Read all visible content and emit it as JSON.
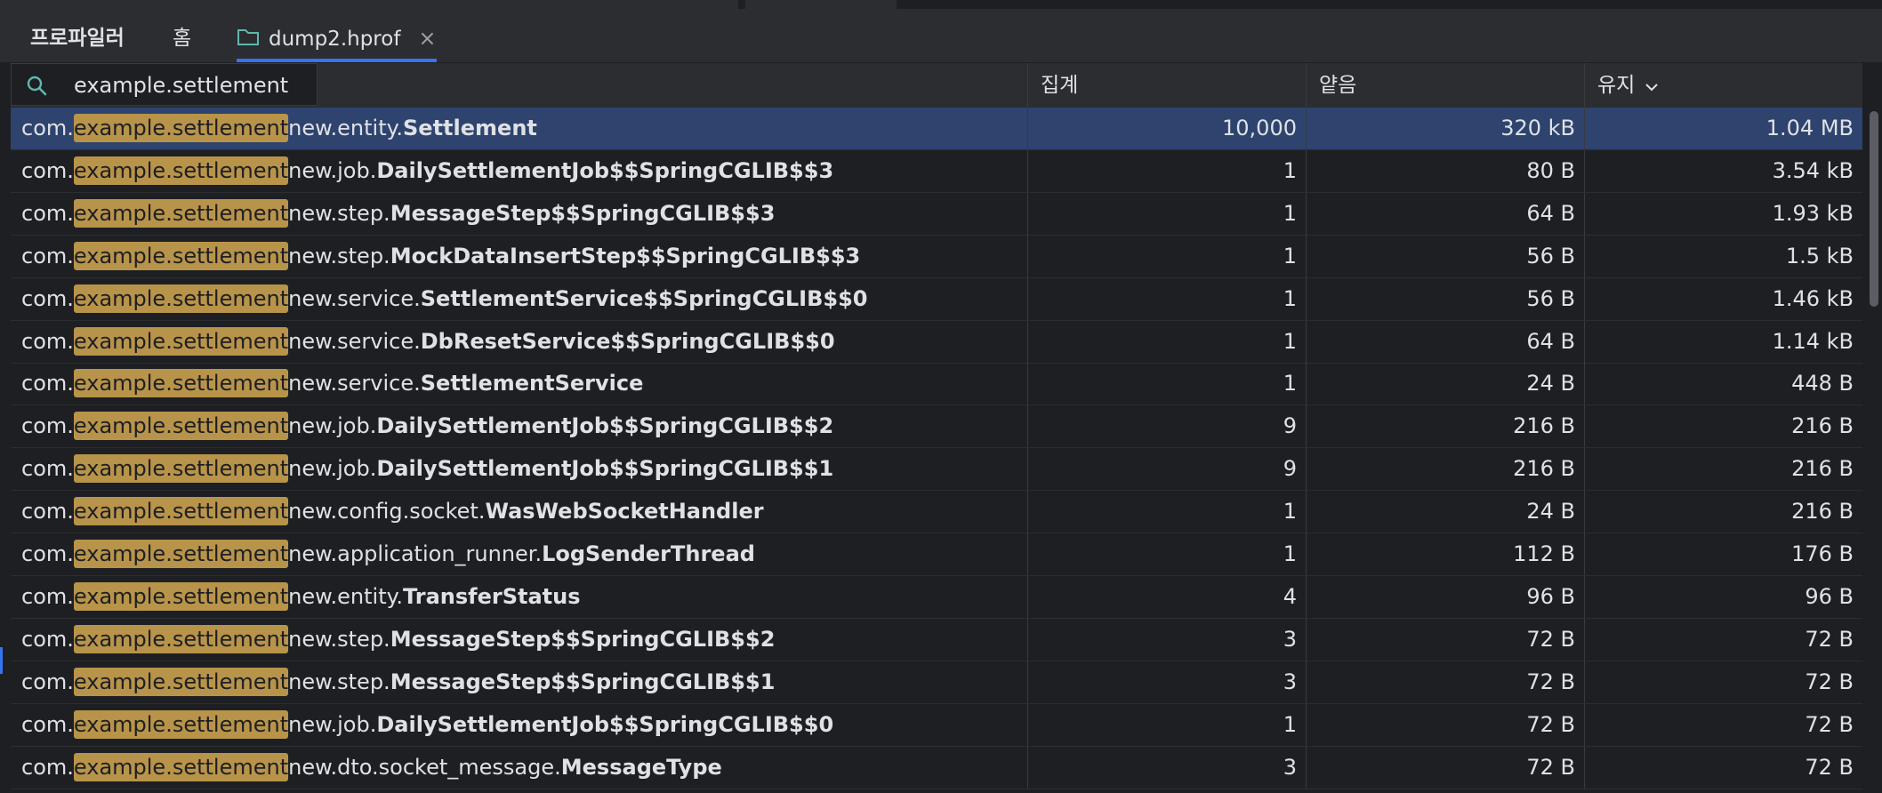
{
  "tabs": [
    {
      "label": "프로파일러"
    },
    {
      "label": "홈"
    },
    {
      "label": "dump2.hprof",
      "icon": "folder-icon",
      "close": "×"
    }
  ],
  "search": {
    "value": "example.settlement",
    "icon": "search-icon"
  },
  "columns": {
    "name": "",
    "count": "집계",
    "shallow": "얕음",
    "retained": "유지"
  },
  "colors": {
    "accent": "#3574f0",
    "highlight": "#b8944a",
    "selected_row": "#2e436e"
  },
  "rows": [
    {
      "prefix": "com.",
      "match": "example.settlement",
      "pkg": "new.entity.",
      "cls": "Settlement",
      "count": "10,000",
      "shallow": "320 kB",
      "retained": "1.04 MB",
      "selected": true
    },
    {
      "prefix": "com.",
      "match": "example.settlement",
      "pkg": "new.job.",
      "cls": "DailySettlementJob$$SpringCGLIB$$3",
      "count": "1",
      "shallow": "80 B",
      "retained": "3.54 kB"
    },
    {
      "prefix": "com.",
      "match": "example.settlement",
      "pkg": "new.step.",
      "cls": "MessageStep$$SpringCGLIB$$3",
      "count": "1",
      "shallow": "64 B",
      "retained": "1.93 kB"
    },
    {
      "prefix": "com.",
      "match": "example.settlement",
      "pkg": "new.step.",
      "cls": "MockDataInsertStep$$SpringCGLIB$$3",
      "count": "1",
      "shallow": "56 B",
      "retained": "1.5 kB"
    },
    {
      "prefix": "com.",
      "match": "example.settlement",
      "pkg": "new.service.",
      "cls": "SettlementService$$SpringCGLIB$$0",
      "count": "1",
      "shallow": "56 B",
      "retained": "1.46 kB"
    },
    {
      "prefix": "com.",
      "match": "example.settlement",
      "pkg": "new.service.",
      "cls": "DbResetService$$SpringCGLIB$$0",
      "count": "1",
      "shallow": "64 B",
      "retained": "1.14 kB"
    },
    {
      "prefix": "com.",
      "match": "example.settlement",
      "pkg": "new.service.",
      "cls": "SettlementService",
      "count": "1",
      "shallow": "24 B",
      "retained": "448 B"
    },
    {
      "prefix": "com.",
      "match": "example.settlement",
      "pkg": "new.job.",
      "cls": "DailySettlementJob$$SpringCGLIB$$2",
      "count": "9",
      "shallow": "216 B",
      "retained": "216 B"
    },
    {
      "prefix": "com.",
      "match": "example.settlement",
      "pkg": "new.job.",
      "cls": "DailySettlementJob$$SpringCGLIB$$1",
      "count": "9",
      "shallow": "216 B",
      "retained": "216 B"
    },
    {
      "prefix": "com.",
      "match": "example.settlement",
      "pkg": "new.config.socket.",
      "cls": "WasWebSocketHandler",
      "count": "1",
      "shallow": "24 B",
      "retained": "216 B"
    },
    {
      "prefix": "com.",
      "match": "example.settlement",
      "pkg": "new.application_runner.",
      "cls": "LogSenderThread",
      "count": "1",
      "shallow": "112 B",
      "retained": "176 B"
    },
    {
      "prefix": "com.",
      "match": "example.settlement",
      "pkg": "new.entity.",
      "cls": "TransferStatus",
      "count": "4",
      "shallow": "96 B",
      "retained": "96 B"
    },
    {
      "prefix": "com.",
      "match": "example.settlement",
      "pkg": "new.step.",
      "cls": "MessageStep$$SpringCGLIB$$2",
      "count": "3",
      "shallow": "72 B",
      "retained": "72 B"
    },
    {
      "prefix": "com.",
      "match": "example.settlement",
      "pkg": "new.step.",
      "cls": "MessageStep$$SpringCGLIB$$1",
      "count": "3",
      "shallow": "72 B",
      "retained": "72 B"
    },
    {
      "prefix": "com.",
      "match": "example.settlement",
      "pkg": "new.job.",
      "cls": "DailySettlementJob$$SpringCGLIB$$0",
      "count": "1",
      "shallow": "72 B",
      "retained": "72 B"
    },
    {
      "prefix": "com.",
      "match": "example.settlement",
      "pkg": "new.dto.socket_message.",
      "cls": "MessageType",
      "count": "3",
      "shallow": "72 B",
      "retained": "72 B"
    }
  ]
}
